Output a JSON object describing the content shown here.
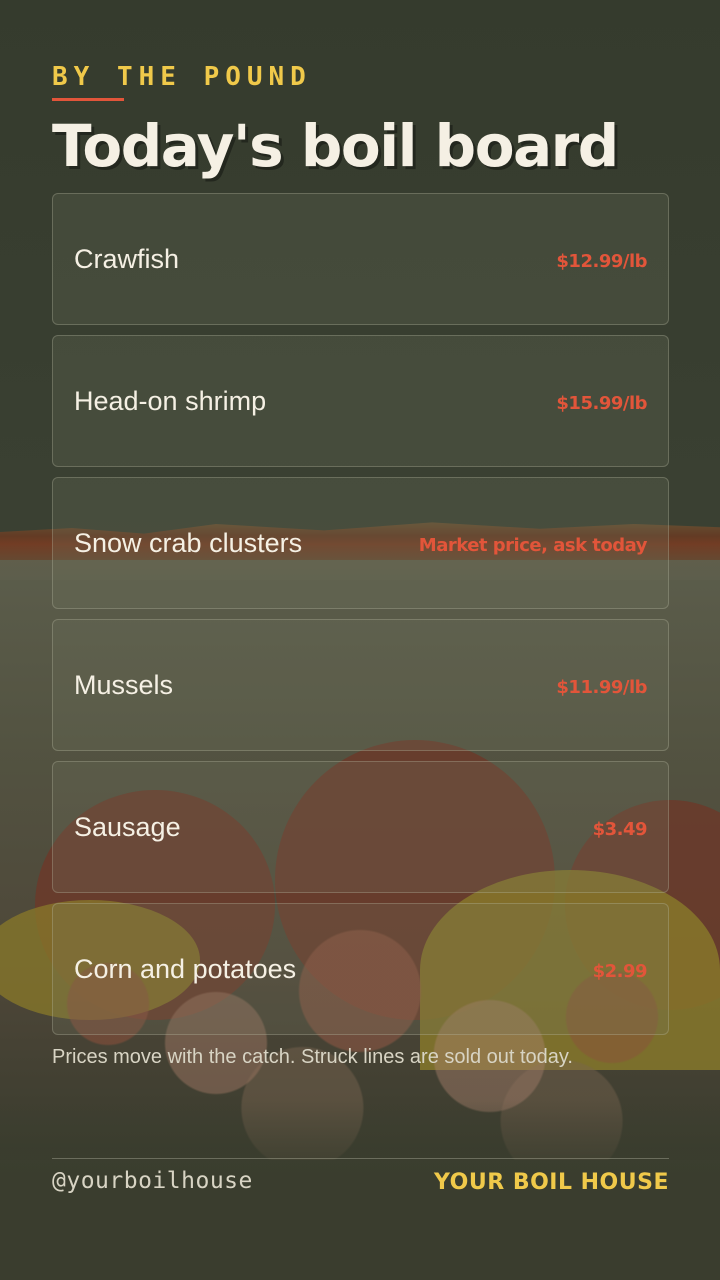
{
  "header": {
    "kicker": "BY THE POUND",
    "title": "Today's boil board"
  },
  "menu": {
    "items": [
      {
        "name": "Crawfish",
        "price": "$12.99/lb"
      },
      {
        "name": "Head-on shrimp",
        "price": "$15.99/lb"
      },
      {
        "name": "Snow crab clusters",
        "price": "Market price, ask today"
      },
      {
        "name": "Mussels",
        "price": "$11.99/lb"
      },
      {
        "name": "Sausage",
        "price": "$3.49"
      },
      {
        "name": "Corn and potatoes",
        "price": "$2.99"
      }
    ]
  },
  "note": "Prices move with the catch. Struck lines are sold out today.",
  "footer": {
    "handle": "@yourboilhouse",
    "brand": "YOUR BOIL HOUSE"
  },
  "colors": {
    "background": "#3a3f30",
    "accent_yellow": "#f0c94a",
    "accent_red": "#e2553a",
    "text_light": "#f5f0e4"
  }
}
